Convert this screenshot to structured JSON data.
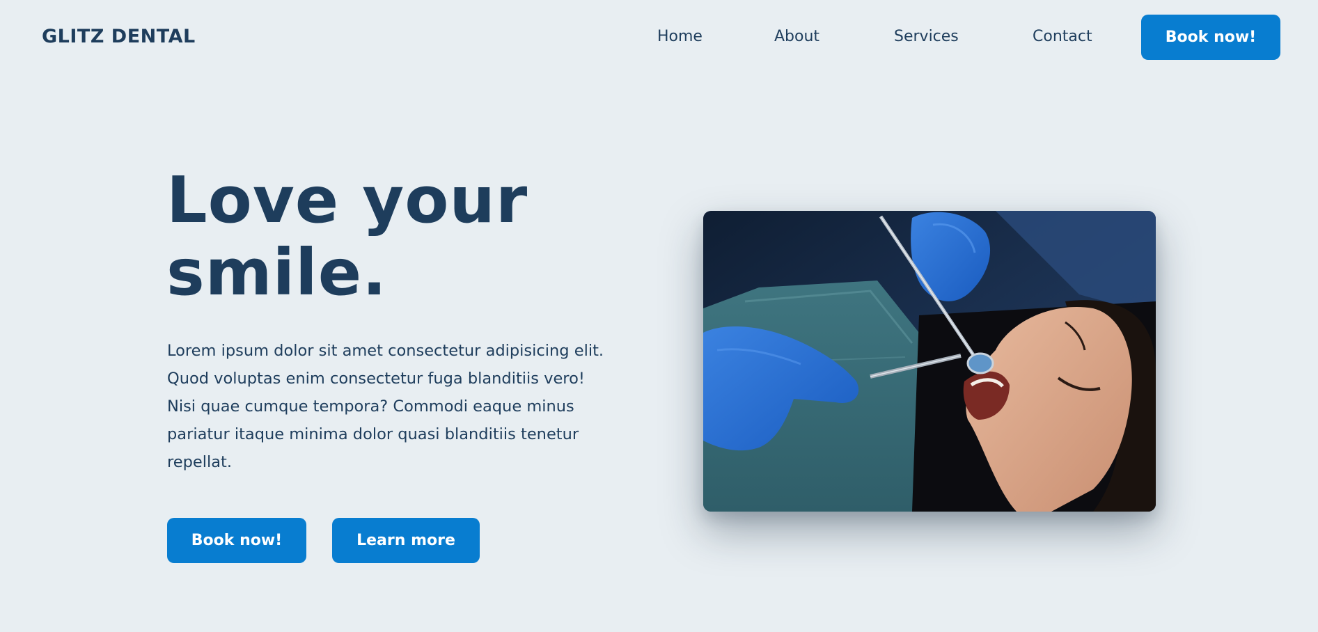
{
  "header": {
    "logo": "GLITZ DENTAL",
    "nav": [
      "Home",
      "About",
      "Services",
      "Contact"
    ],
    "cta": "Book now!"
  },
  "hero": {
    "title": "Love your smile.",
    "body": "Lorem ipsum dolor sit amet consectetur adipisicing elit. Quod voluptas enim consectetur fuga blanditiis vero! Nisi quae cumque tempora? Commodi eaque minus pariatur itaque minima dolor quasi blanditiis tenetur repellat.",
    "primary_button": "Book now!",
    "secondary_button": "Learn more",
    "image": "Photo of a dentist in blue gloves examining a patient's teeth with a dental mirror"
  },
  "colors": {
    "background": "#e8eef2",
    "text": "#1e3d5c",
    "accent": "#087dd0"
  }
}
